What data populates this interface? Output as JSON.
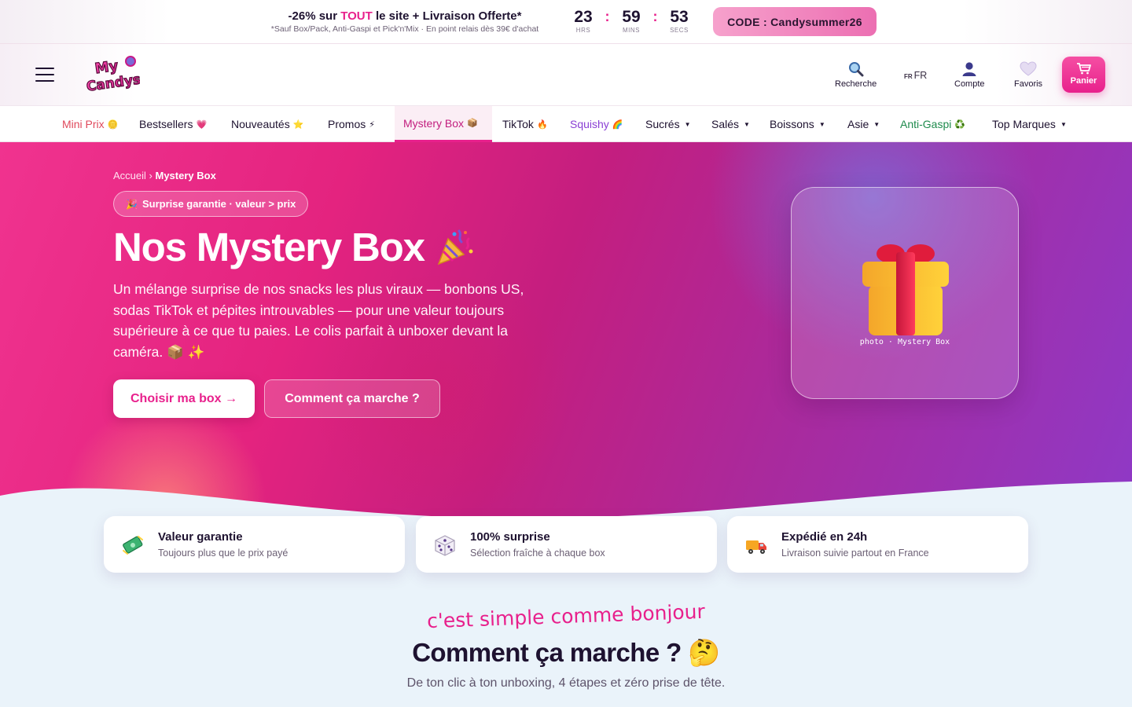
{
  "promo": {
    "pre": "-26% sur ",
    "highlight": "TOUT",
    "post": " le site + Livraison Offerte*",
    "note": "*Sauf Box/Pack, Anti-Gaspi et Pick'n'Mix · En point relais dès 39€ d'achat",
    "timer": {
      "hours": "23",
      "hours_label": "HRS",
      "minutes": "59",
      "minutes_label": "MINS",
      "seconds": "53",
      "seconds_label": "SECS",
      "separator": ":"
    },
    "code_label": "CODE : Candysummer26"
  },
  "header": {
    "logo_text": "My Candy's",
    "search_label": "Recherche",
    "lang_flag": "FR",
    "lang_label": "FR",
    "account_label": "Compte",
    "favorites_label": "Favoris",
    "cart_label": "Panier"
  },
  "nav": {
    "items": [
      {
        "label": "Mini Prix",
        "emoji": "🪙"
      },
      {
        "label": "Bestsellers",
        "emoji": "💗"
      },
      {
        "label": "Nouveautés",
        "emoji": "⭐"
      },
      {
        "label": "Promos",
        "emoji": "⚡"
      },
      {
        "label": "Mystery Box",
        "emoji": "📦"
      },
      {
        "label": "TikTok",
        "emoji": "🔥"
      },
      {
        "label": "Squishy",
        "emoji": "🌈"
      },
      {
        "label": "Sucrés",
        "caret": "▼"
      },
      {
        "label": "Salés",
        "caret": "▼"
      },
      {
        "label": "Boissons",
        "caret": "▼"
      },
      {
        "label": "Asie",
        "caret": "▼"
      },
      {
        "label": "Anti-Gaspi",
        "emoji": "♻️"
      },
      {
        "label": "Top Marques",
        "caret": "▼"
      }
    ]
  },
  "hero": {
    "breadcrumb_home": "Accueil",
    "breadcrumb_sep": " › ",
    "breadcrumb_current": "Mystery Box",
    "pill_icon": "🎉",
    "pill_text": "Surprise garantie · valeur > prix",
    "title": "Nos Mystery Box",
    "title_emoji": "🎉",
    "description": "Un mélange surprise de nos snacks les plus viraux — bonbons US, sodas TikTok et pépites introuvables — pour une valeur toujours supérieure à ce que tu paies. Le colis parfait à unboxer devant la caméra. 📦 ✨",
    "cta_primary": "Choisir ma box →",
    "cta_secondary": "Comment ça marche ?",
    "photo_label": "photo · Mystery Box"
  },
  "features": [
    {
      "icon": "money-icon",
      "title": "Valeur garantie",
      "subtitle": "Toujours plus que le prix payé"
    },
    {
      "icon": "dice-icon",
      "title": "100% surprise",
      "subtitle": "Sélection fraîche à chaque box"
    },
    {
      "icon": "truck-icon",
      "title": "Expédié en 24h",
      "subtitle": "Livraison suivie partout en France"
    }
  ],
  "how": {
    "kicker": "c'est simple comme bonjour",
    "title": "Comment ça marche ?",
    "title_emoji": "🤔",
    "subtitle": "De ton clic à ton unboxing, 4 étapes et zéro prise de tête."
  },
  "colors": {
    "brand_pink": "#e8208c",
    "dark": "#1e1230",
    "mini_prix": "#e0495c",
    "squishy": "#8a3fd4",
    "anti_gaspi": "#1e8a4c"
  }
}
